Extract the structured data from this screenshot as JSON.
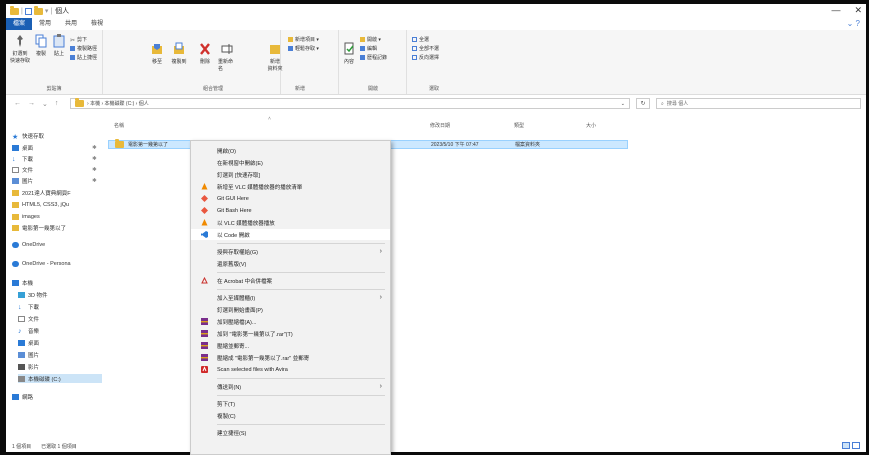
{
  "window": {
    "title": "個人",
    "minimize": "—",
    "close": "✕"
  },
  "tabs": [
    "檔案",
    "常用",
    "共用",
    "檢視"
  ],
  "ribbon": {
    "clipboard": {
      "label": "剪貼簿",
      "pin": "釘選到\n快速存取",
      "copy": "複製",
      "paste": "貼上",
      "cut": "剪下",
      "copy_path": "複製路徑",
      "paste_shortcut": "貼上捷徑"
    },
    "organize": {
      "label": "組合管理",
      "move_to": "移至",
      "copy_to": "複製到",
      "delete": "刪除",
      "rename": "重新命名"
    },
    "new": {
      "label": "新增",
      "new_folder": "新增\n資料夾",
      "new_item": "新增項目 ▾",
      "easy_access": "輕鬆存取 ▾"
    },
    "open": {
      "label": "開啟",
      "properties": "內容",
      "open": "開啟 ▾",
      "edit": "編輯",
      "history": "歷程記錄"
    },
    "select": {
      "label": "選取",
      "select_all": "全選",
      "select_none": "全部不選",
      "invert": "反向選擇"
    }
  },
  "address": {
    "path": [
      "本機",
      "本機磁碟 (C:)",
      "個人"
    ],
    "search_placeholder": "搜尋 個人",
    "refresh": "↻"
  },
  "nav": {
    "quick_access": "快速存取",
    "items": [
      {
        "label": "桌面",
        "pin": "✱"
      },
      {
        "label": "下載",
        "pin": "✱"
      },
      {
        "label": "文件",
        "pin": "✱"
      },
      {
        "label": "圖片",
        "pin": "✱"
      },
      {
        "label": "2021達人寶典網頁F",
        "pin": ""
      },
      {
        "label": "HTML5, CSS3, jQu",
        "pin": ""
      },
      {
        "label": "images",
        "pin": ""
      },
      {
        "label": "電影第一幾第以了",
        "pin": ""
      }
    ],
    "onedrive": "OneDrive",
    "onedrive_personal": "OneDrive - Persona",
    "this_pc": "本機",
    "pc_items": [
      "3D 物件",
      "下載",
      "文件",
      "音樂",
      "桌面",
      "圖片",
      "影片",
      "本機磁碟 (C:)"
    ],
    "network": "網路"
  },
  "columns": {
    "name": "名稱",
    "date": "修改日期",
    "type": "類型",
    "size": "大小"
  },
  "file": {
    "name": "電影第一幾第以了",
    "date": "2023/5/10 下午 07:47",
    "type": "檔案資料夾"
  },
  "status": {
    "count": "1 個項目",
    "selected": "已選取 1 個項目"
  },
  "context_menu": [
    {
      "label": "開啟(O)",
      "icon": "",
      "arrow": false
    },
    {
      "label": "在新視窗中開啟(E)",
      "icon": "",
      "arrow": false
    },
    {
      "label": "釘選到 [快速存取]",
      "icon": "",
      "arrow": false
    },
    {
      "label": "新增至 VLC 媒體播放器的播放清單",
      "icon": "vlc-icon",
      "arrow": false
    },
    {
      "label": "Git GUI Here",
      "icon": "git-icon",
      "arrow": false
    },
    {
      "label": "Git Bash Here",
      "icon": "git-icon",
      "arrow": false
    },
    {
      "label": "以 VLC 媒體播放器播放",
      "icon": "vlc-icon",
      "arrow": false
    },
    {
      "label": "以 Code 開啟",
      "icon": "vscode-icon",
      "arrow": false
    },
    {
      "sep": true
    },
    {
      "label": "授與存取權給(G)",
      "icon": "",
      "arrow": true
    },
    {
      "label": "還原舊版(V)",
      "icon": "",
      "arrow": false
    },
    {
      "sep": true
    },
    {
      "label": "在 Acrobat 中合併檔案",
      "icon": "acrobat-icon",
      "arrow": false
    },
    {
      "sep": true
    },
    {
      "label": "加入至媒體櫃(I)",
      "icon": "",
      "arrow": true
    },
    {
      "label": "釘選到開始畫面(P)",
      "icon": "",
      "arrow": false
    },
    {
      "label": "加到壓縮檔(A)...",
      "icon": "winrar-icon",
      "arrow": false
    },
    {
      "label": "加到 \"電影第一幾第以了.rar\"(T)",
      "icon": "winrar-icon",
      "arrow": false
    },
    {
      "label": "壓縮並郵寄...",
      "icon": "winrar-icon",
      "arrow": false
    },
    {
      "label": "壓縮成 \"電影第一幾第以了.rar\" 並郵寄",
      "icon": "winrar-icon",
      "arrow": false
    },
    {
      "label": "Scan selected files with Avira",
      "icon": "avira-icon",
      "arrow": false
    },
    {
      "sep": true
    },
    {
      "label": "傳送到(N)",
      "icon": "",
      "arrow": true
    },
    {
      "sep": true
    },
    {
      "label": "剪下(T)",
      "icon": "",
      "arrow": false
    },
    {
      "label": "複製(C)",
      "icon": "",
      "arrow": false
    },
    {
      "sep": true
    },
    {
      "label": "建立捷徑(S)",
      "icon": "",
      "arrow": false
    }
  ],
  "colors": {
    "accent": "#1a5fb4",
    "folder": "#e8b93a",
    "selection": "#cce8ff"
  }
}
